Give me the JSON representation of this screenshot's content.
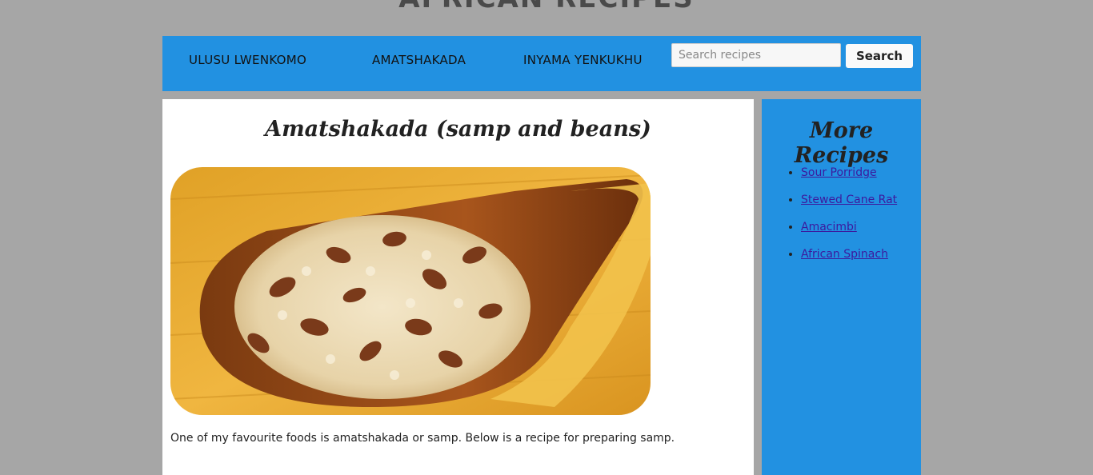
{
  "site": {
    "title": "AFRICAN RECIPES"
  },
  "nav": {
    "links": [
      "ULUSU LWENKOMO",
      "AMATSHAKADA",
      "INYAMA YENKUKHU"
    ],
    "search_placeholder": "Search recipes",
    "search_button": "Search"
  },
  "main": {
    "title": "Amatshakada (samp and beans)",
    "image_icon": "samp-and-beans-photo",
    "intro": "One of my favourite foods is amatshakada or samp. Below is a recipe for preparing samp."
  },
  "sidebar": {
    "title": "More Recipes",
    "recipes": [
      "Sour Porridge",
      "Stewed Cane Rat",
      "Amacimbi",
      "African Spinach"
    ]
  },
  "colors": {
    "background": "#a6a6a6",
    "accent": "#2291e1",
    "link": "#3c1a9e"
  }
}
